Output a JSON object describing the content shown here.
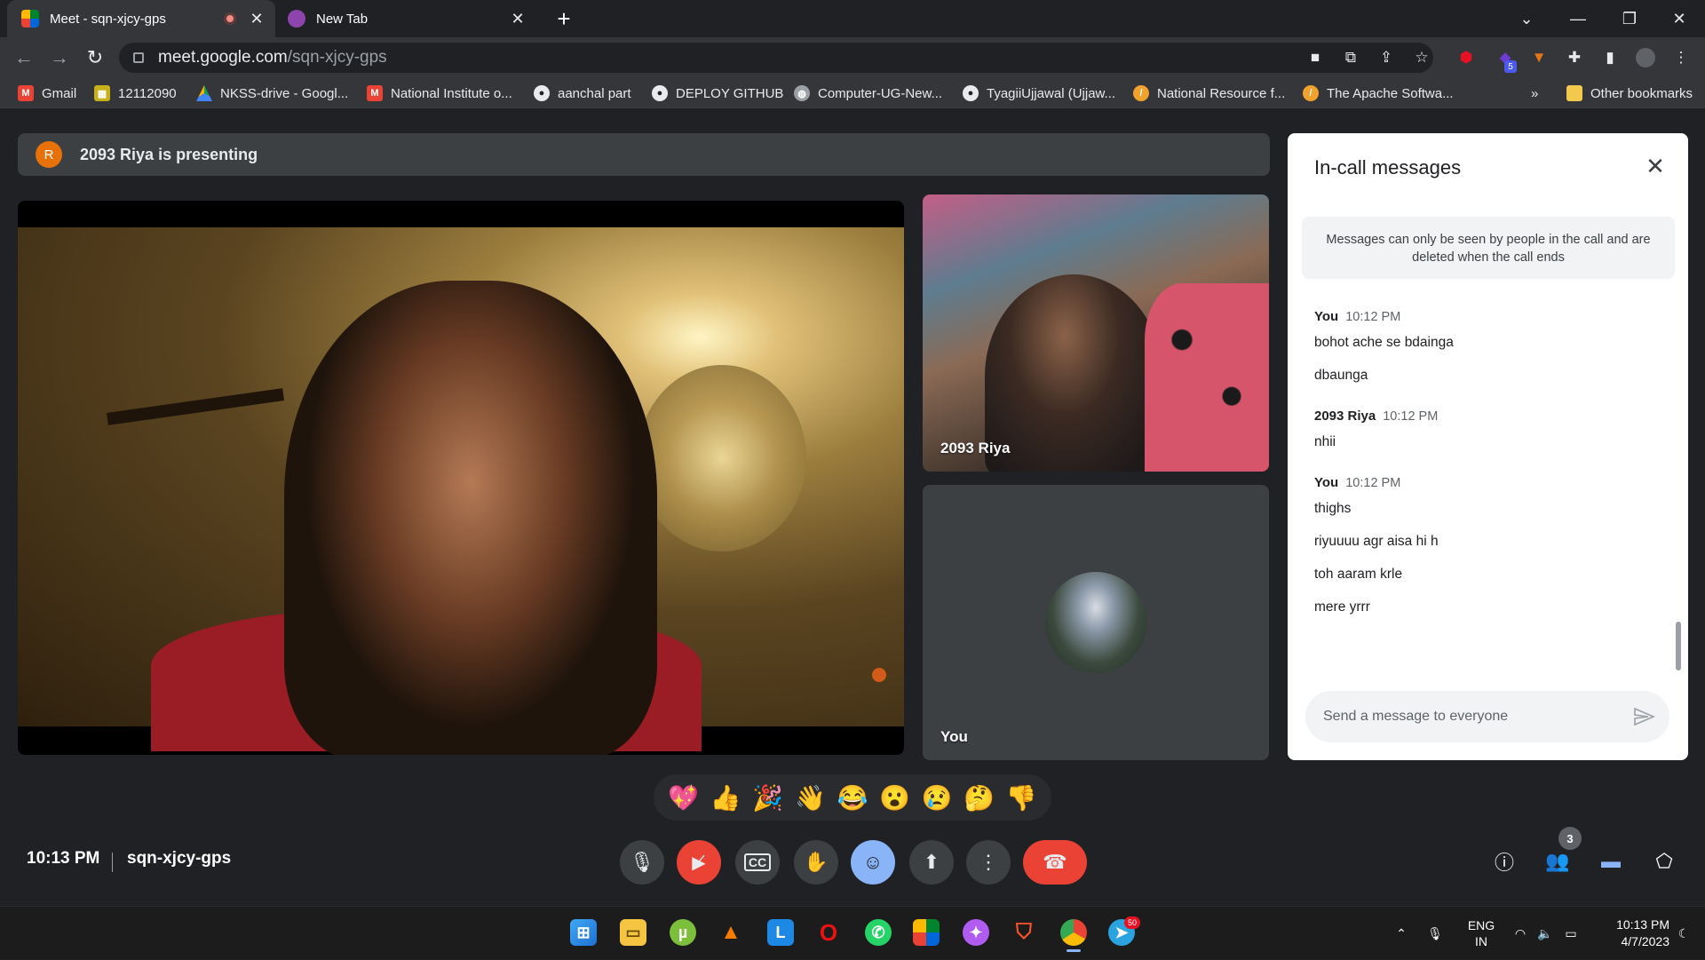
{
  "browser": {
    "tabs": [
      {
        "title": "Meet - sqn-xjcy-gps",
        "active": true,
        "recording": true
      },
      {
        "title": "New Tab",
        "active": false
      }
    ],
    "url_host": "meet.google.com",
    "url_path": "/sqn-xjcy-gps",
    "bookmarks": [
      {
        "label": "Gmail",
        "icon": "gmail-icon"
      },
      {
        "label": "12112090",
        "icon": "sheet-icon"
      },
      {
        "label": "NKSS-drive - Googl...",
        "icon": "drive-icon"
      },
      {
        "label": "National Institute o...",
        "icon": "gmail-icon"
      },
      {
        "label": "aanchal part",
        "icon": "github-icon"
      },
      {
        "label": "DEPLOY GITHUB",
        "icon": "github-icon"
      },
      {
        "label": "Computer-UG-New...",
        "icon": "globe-icon"
      },
      {
        "label": "TyagiiUjjawal (Ujjaw...",
        "icon": "github-icon"
      },
      {
        "label": "National Resource f...",
        "icon": "feather-icon"
      },
      {
        "label": "The Apache Softwa...",
        "icon": "feather-icon"
      }
    ],
    "more_bookmarks": "»",
    "other_bookmarks": "Other bookmarks",
    "extension_badge": "5"
  },
  "meet": {
    "presenter_initial": "R",
    "presenter_banner": "2093 Riya is presenting",
    "tiles": [
      {
        "name": "2093 Riya"
      },
      {
        "name": "You"
      }
    ],
    "reactions": [
      "💖",
      "👍",
      "🎉",
      "👋",
      "😂",
      "😮",
      "😢",
      "🤔",
      "👎"
    ],
    "time": "10:13 PM",
    "meeting_code": "sqn-xjcy-gps",
    "participants_count": "3"
  },
  "chat": {
    "title": "In-call messages",
    "notice": "Messages can only be seen by people in the call and are deleted when the call ends",
    "groups": [
      {
        "sender": "You",
        "time": "10:12 PM",
        "messages": [
          "bohot ache se bdainga",
          "dbaunga"
        ]
      },
      {
        "sender": "2093 Riya",
        "time": "10:12 PM",
        "messages": [
          "nhii"
        ]
      },
      {
        "sender": "You",
        "time": "10:12 PM",
        "messages": [
          "thighs",
          "riyuuuu agr aisa hi h",
          "toh aaram krle",
          "mere yrrr"
        ]
      }
    ],
    "composer_placeholder": "Send a message to everyone"
  },
  "taskbar": {
    "language": "ENG",
    "region": "IN",
    "time": "10:13 PM",
    "date": "4/7/2023",
    "telegram_badge": "50"
  },
  "colors": {
    "meet_bg": "#202124",
    "end_call_red": "#ea4335",
    "accent_blue": "#8ab4f8",
    "presenter_avatar": "#e8710a"
  }
}
